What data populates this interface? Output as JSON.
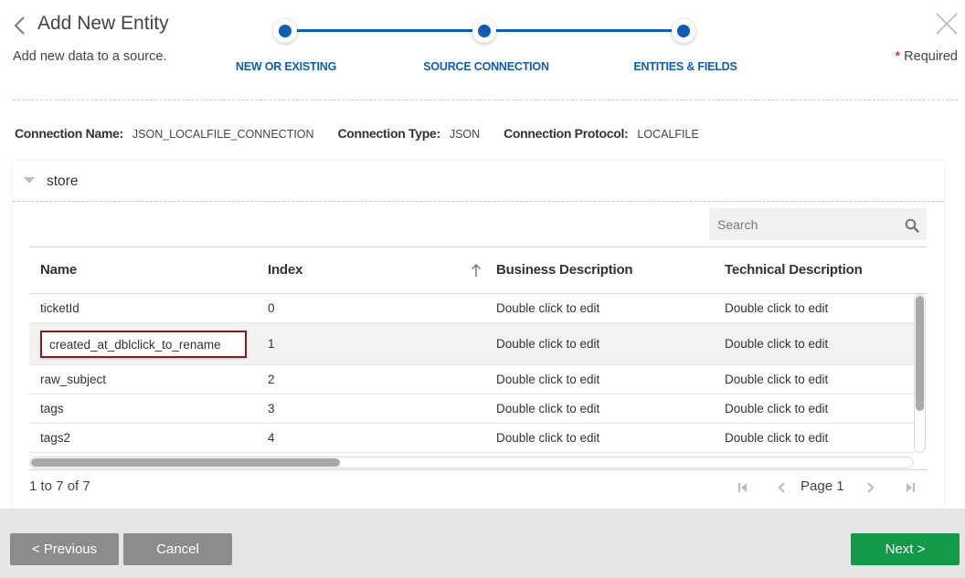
{
  "header": {
    "title": "Add New Entity",
    "subtitle": "Add new data to a source.",
    "required_label": "Required",
    "required_marker": "*"
  },
  "stepper": {
    "steps": [
      {
        "label": "NEW OR EXISTING",
        "state": "complete"
      },
      {
        "label": "SOURCE CONNECTION",
        "state": "complete"
      },
      {
        "label": "ENTITIES & FIELDS",
        "state": "active"
      }
    ],
    "accent_color": "#0f5db4"
  },
  "connection": {
    "name_label": "Connection Name:",
    "name_value": "JSON_LOCALFILE_CONNECTION",
    "type_label": "Connection Type:",
    "type_value": "JSON",
    "protocol_label": "Connection Protocol:",
    "protocol_value": "LOCALFILE"
  },
  "panel": {
    "title": "store",
    "expanded": true,
    "search": {
      "placeholder": "Search",
      "value": ""
    },
    "table": {
      "columns": [
        "Name",
        "Index",
        "Business Description",
        "Technical Description"
      ],
      "sort": {
        "column": "Index",
        "direction": "ascending"
      },
      "rows": [
        {
          "name": "ticketId",
          "index": "0",
          "business": "Double click to edit",
          "technical": "Double click to edit",
          "editing": false
        },
        {
          "name": "created_at_dblclick_to_rename",
          "index": "1",
          "business": "Double click to edit",
          "technical": "Double click to edit",
          "editing": true
        },
        {
          "name": "raw_subject",
          "index": "2",
          "business": "Double click to edit",
          "technical": "Double click to edit",
          "editing": false
        },
        {
          "name": "tags",
          "index": "3",
          "business": "Double click to edit",
          "technical": "Double click to edit",
          "editing": false
        },
        {
          "name": "tags2",
          "index": "4",
          "business": "Double click to edit",
          "technical": "Double click to edit",
          "editing": false
        }
      ]
    },
    "pagination": {
      "summary": "1 to 7 of 7",
      "page_label": "Page",
      "page_number": "1"
    }
  },
  "footer": {
    "previous_label": "< Previous",
    "cancel_label": "Cancel",
    "next_label": "Next >",
    "next_color": "#139a48"
  }
}
